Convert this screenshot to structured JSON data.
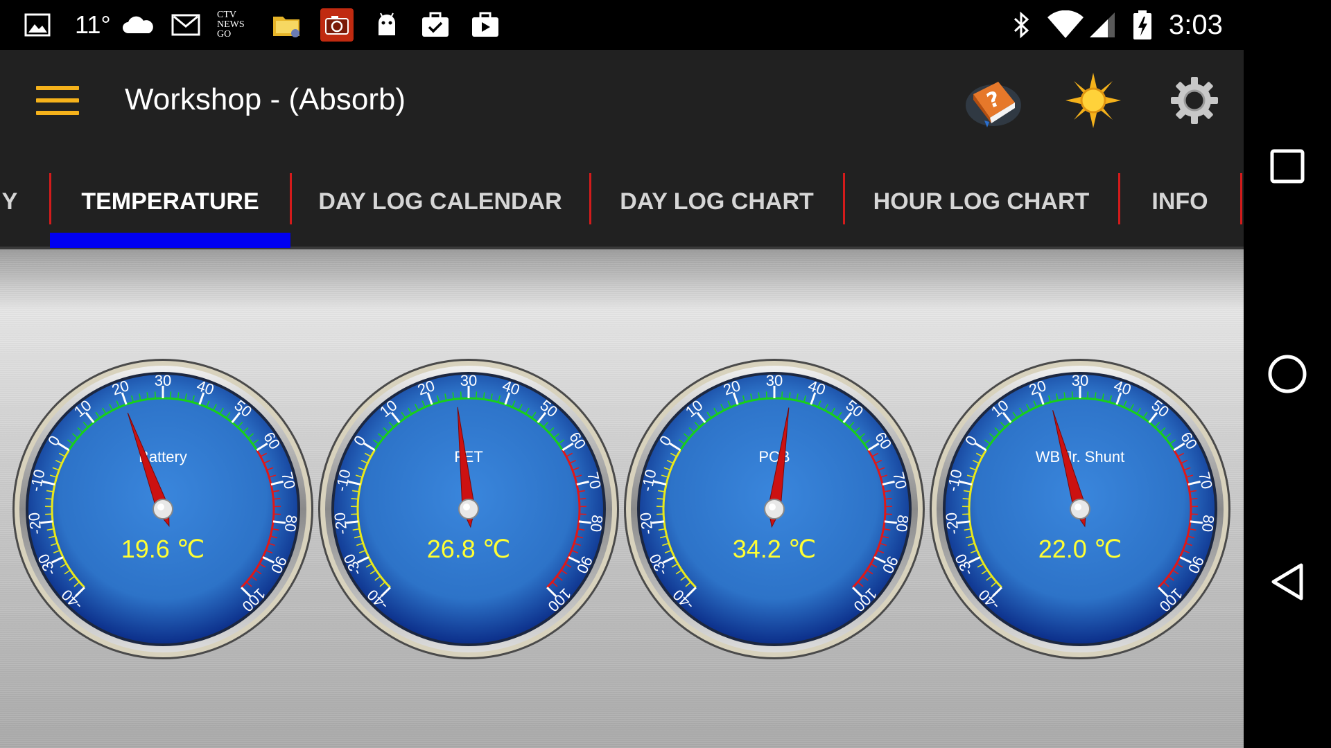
{
  "status_bar": {
    "temperature": "11°",
    "news_icon_text": "CTV NEWS GO",
    "time": "3:03",
    "left_icons": [
      "image-icon",
      "cloud-icon",
      "gmail-icon",
      "news-go-icon",
      "folder-icon",
      "camera-app-icon",
      "android-icon",
      "clipboard-check-icon",
      "media-briefcase-icon"
    ],
    "right_icons": [
      "bluetooth-icon",
      "wifi-icon",
      "cell-signal-icon",
      "battery-charging-icon"
    ]
  },
  "app_bar": {
    "title": "Workshop - (Absorb)",
    "actions": [
      "help-book-icon",
      "sun-icon",
      "gear-icon"
    ]
  },
  "tabs": [
    {
      "label": "Y",
      "active": false
    },
    {
      "label": "TEMPERATURE",
      "active": true
    },
    {
      "label": "DAY LOG CALENDAR",
      "active": false
    },
    {
      "label": "DAY LOG CHART",
      "active": false
    },
    {
      "label": "HOUR LOG CHART",
      "active": false
    },
    {
      "label": "INFO",
      "active": false
    }
  ],
  "colors": {
    "accent": "#f5b21b",
    "tab_indicator": "#0000f2",
    "tab_separator": "#d31b1b",
    "gauge_face": "#2d73c8",
    "gauge_readout": "#ffff33",
    "needle": "#cc1111",
    "arc_cold": "#e8e81a",
    "arc_normal": "#18d018",
    "arc_hot": "#e01818"
  },
  "gauge_scale": {
    "min": -40,
    "max": 100,
    "major_step": 10,
    "minor_step": 2,
    "labels": [
      "-40",
      "-30",
      "-20",
      "-10",
      "0",
      "10",
      "20",
      "30",
      "40",
      "50",
      "60",
      "70",
      "80",
      "90",
      "100"
    ],
    "zones": [
      {
        "name": "cold",
        "from": -40,
        "to": 0
      },
      {
        "name": "normal",
        "from": 0,
        "to": 60
      },
      {
        "name": "hot",
        "from": 60,
        "to": 100
      }
    ]
  },
  "gauges": [
    {
      "label": "Battery",
      "value": 19.6,
      "readout": "19.6 ℃"
    },
    {
      "label": "FET",
      "value": 26.8,
      "readout": "26.8 ℃"
    },
    {
      "label": "PCB",
      "value": 34.2,
      "readout": "34.2 ℃"
    },
    {
      "label": "WB Jr. Shunt",
      "value": 22.0,
      "readout": "22.0 ℃"
    }
  ],
  "nav_bar": [
    "recents-square-icon",
    "home-circle-icon",
    "back-triangle-icon"
  ]
}
